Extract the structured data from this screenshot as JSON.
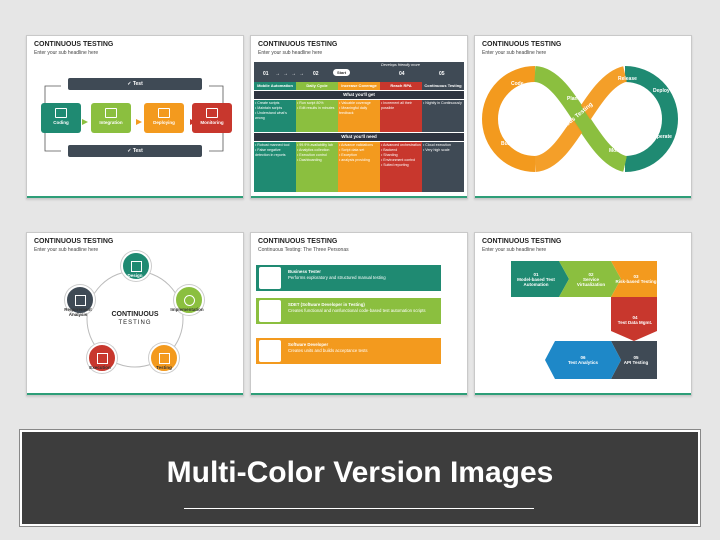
{
  "slides": [
    {
      "title": "CONTINUOUS TESTING",
      "subtitle": "Enter your sub headline here",
      "stages": [
        "Coding",
        "Integration",
        "Deploying",
        "Monitoring"
      ],
      "top_bar": "Test",
      "bottom_bar": "Test"
    },
    {
      "title": "CONTINUOUS TESTING",
      "subtitle": "Enter your sub headline here",
      "steps": [
        "01",
        "02",
        "Start",
        "04",
        "05"
      ],
      "banner_note": "Develops friendly more",
      "columns": [
        "Mobile Automation",
        "Daily Cycle",
        "Increase Coverage",
        "Reach RPA",
        "Continuous Testing"
      ],
      "section1": "What you'll get",
      "section2": "What you'll need",
      "get_rows": [
        [
          "• Create scripts\n• Maintain scripts\n• Understand what's wrong",
          "• Run script 80%\n• Edit results in minutes",
          "• Valuable coverage\n• Meaningful daily feedback",
          "• Increment all their possible",
          "• Nightly in Continuously"
        ]
      ],
      "need_rows": [
        [
          "• Robust manned tool\n• False negative detection in reports",
          "• 99.9% availability lab\n• Analytics collection\n• Execution control\n• Dashboarding",
          "• Advance validations\n• Script data set\n• Exception\n• analysis providing",
          "• Advanced orchestration\n• Backend\n• Sharding\n• Environment control\n• Suited reporting",
          "• Cloud execution\n• Very high scale"
        ]
      ]
    },
    {
      "title": "CONTINUOUS TESTING",
      "subtitle": "Enter your sub headline here",
      "loop_labels": [
        "Code",
        "Plan",
        "Build",
        "Release",
        "Deploy",
        "Operate",
        "Monitor"
      ],
      "center_label": "Continuous Testing"
    },
    {
      "title": "CONTINUOUS TESTING",
      "subtitle": "Enter your sub headline here",
      "cycle": [
        "Design",
        "Implementation",
        "Testing",
        "Execution",
        "Requirement Analysis"
      ],
      "center_line1": "CONTINUOUS",
      "center_line2": "TESTING"
    },
    {
      "title": "CONTINUOUS TESTING",
      "subtitle": "Continuous Testing: The Three Personas",
      "personas": [
        {
          "name": "Business Tester",
          "desc": "Performs exploratory and structured manual testing"
        },
        {
          "name": "SDET (Software Developer in Testing)",
          "desc": "Creates functional and nonfunctional code-based test automation scripts"
        },
        {
          "name": "Software Developer",
          "desc": "Creates units and builds acceptance tests"
        }
      ]
    },
    {
      "title": "CONTINUOUS TESTING",
      "subtitle": "Enter your sub headline here",
      "steps": [
        {
          "num": "01",
          "label": "Model-based Test Automation"
        },
        {
          "num": "02",
          "label": "Service Virtualization"
        },
        {
          "num": "03",
          "label": "Risk-based Testing"
        },
        {
          "num": "04",
          "label": "Test Data Mgmt."
        },
        {
          "num": "05",
          "label": "API Testing"
        },
        {
          "num": "06",
          "label": "Test Analytics"
        }
      ]
    }
  ],
  "banner": {
    "title": "Multi-Color Version Images"
  },
  "colors": {
    "teal": "#1f8a72",
    "green": "#8bbf3f",
    "orange": "#f39a1e",
    "red": "#c8372d",
    "navy": "#3f4a55",
    "dark": "#3d3d3d"
  }
}
